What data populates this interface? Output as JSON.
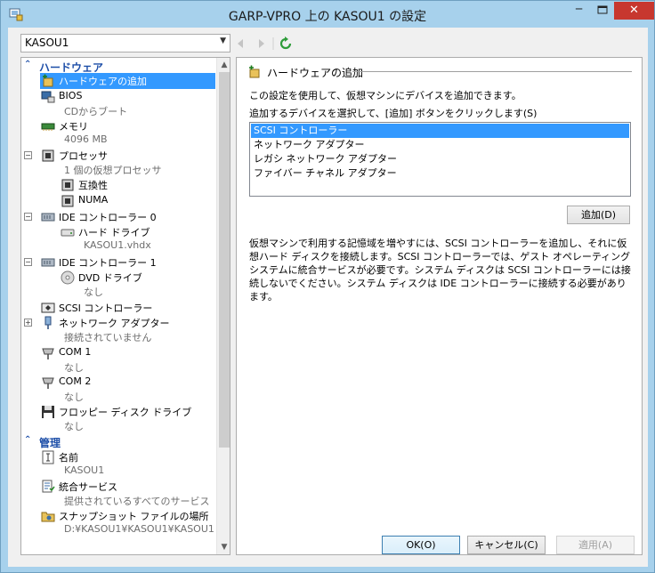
{
  "window": {
    "title": "GARP-VPRO 上の KASOU1 の設定",
    "minimize": "─",
    "close": "✕"
  },
  "vm_selector": {
    "value": "KASOU1"
  },
  "tree": {
    "hardware_header": "ハードウェア",
    "add_hardware": "ハードウェアの追加",
    "bios": {
      "label": "BIOS",
      "sub": "CDからブート"
    },
    "memory": {
      "label": "メモリ",
      "sub": "4096 MB"
    },
    "processor": {
      "label": "プロセッサ",
      "sub": "1 個の仮想プロセッサ"
    },
    "compat": {
      "label": "互換性"
    },
    "numa": {
      "label": "NUMA"
    },
    "ide0": {
      "label": "IDE コントローラー 0"
    },
    "hdd": {
      "label": "ハード ドライブ",
      "sub": "KASOU1.vhdx"
    },
    "ide1": {
      "label": "IDE コントローラー 1"
    },
    "dvd": {
      "label": "DVD ドライブ",
      "sub": "なし"
    },
    "scsi": {
      "label": "SCSI コントローラー"
    },
    "network": {
      "label": "ネットワーク アダプター",
      "sub": "接続されていません"
    },
    "com1": {
      "label": "COM 1",
      "sub": "なし"
    },
    "com2": {
      "label": "COM 2",
      "sub": "なし"
    },
    "floppy": {
      "label": "フロッピー ディスク ドライブ",
      "sub": "なし"
    },
    "management_header": "管理",
    "name": {
      "label": "名前",
      "sub": "KASOU1"
    },
    "integration": {
      "label": "統合サービス",
      "sub": "提供されているすべてのサービス"
    },
    "snapshot": {
      "label": "スナップショット ファイルの場所",
      "sub": "D:¥KASOU1¥KASOU1¥KASOU1"
    }
  },
  "panel": {
    "heading": "ハードウェアの追加",
    "intro": "この設定を使用して、仮想マシンにデバイスを追加できます。",
    "select_prompt": "追加するデバイスを選択して、[追加] ボタンをクリックします(S)",
    "devices": [
      "SCSI コントローラー",
      "ネットワーク アダプター",
      "レガシ ネットワーク アダプター",
      "ファイバー チャネル アダプター"
    ],
    "add_button": "追加(D)",
    "info": "仮想マシンで利用する記憶域を増やすには、SCSI コントローラーを追加し、それに仮想ハード ディスクを接続します。SCSI コントローラーでは、ゲスト オペレーティング システムに統合サービスが必要です。システム ディスクは SCSI コントローラーには接続しないでください。システム ディスクは IDE コントローラーに接続する必要があります。"
  },
  "footer": {
    "ok": "OK(O)",
    "cancel": "キャンセル(C)",
    "apply": "適用(A)"
  },
  "colors": {
    "accent": "#3399ff",
    "title_bar": "#a7d1ec",
    "section": "#1d4ea8",
    "close": "#c7372f"
  }
}
